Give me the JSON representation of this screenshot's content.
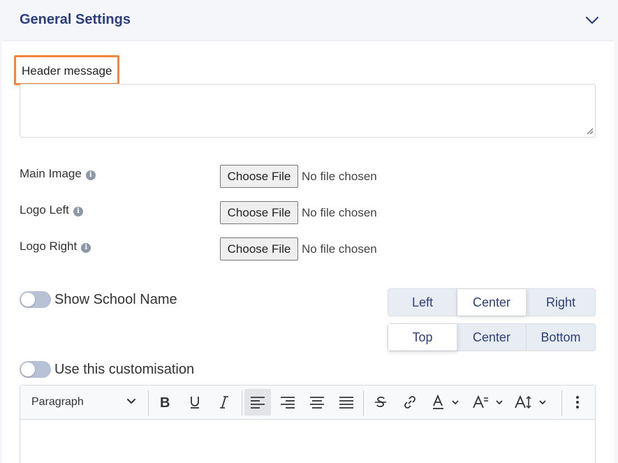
{
  "panel": {
    "title": "General Settings"
  },
  "header_message": {
    "label": "Header message",
    "value": "",
    "placeholder": ""
  },
  "files": [
    {
      "label": "Main Image",
      "button": "Choose File",
      "status": "No file chosen"
    },
    {
      "label": "Logo Left",
      "button": "Choose File",
      "status": "No file chosen"
    },
    {
      "label": "Logo Right",
      "button": "Choose File",
      "status": "No file chosen"
    }
  ],
  "toggles": {
    "show_school_name": {
      "label": "Show School Name",
      "on": false
    },
    "use_customisation": {
      "label": "Use this customisation",
      "on": false
    }
  },
  "horizontal_align": {
    "options": [
      "Left",
      "Center",
      "Right"
    ],
    "selected": "Center"
  },
  "vertical_align": {
    "options": [
      "Top",
      "Center",
      "Bottom"
    ],
    "selected": "Top"
  },
  "editor": {
    "block_format": "Paragraph",
    "toolbar": [
      "bold",
      "underline",
      "italic",
      "align-left",
      "align-right",
      "align-center",
      "justify",
      "strikethrough",
      "link",
      "font-color",
      "font-size",
      "text-size",
      "more"
    ],
    "active_tool": "align-left"
  },
  "colors": {
    "accent": "#2b3f7e",
    "highlight": "#f4843e",
    "toggle_off": "#b7c2d6"
  }
}
